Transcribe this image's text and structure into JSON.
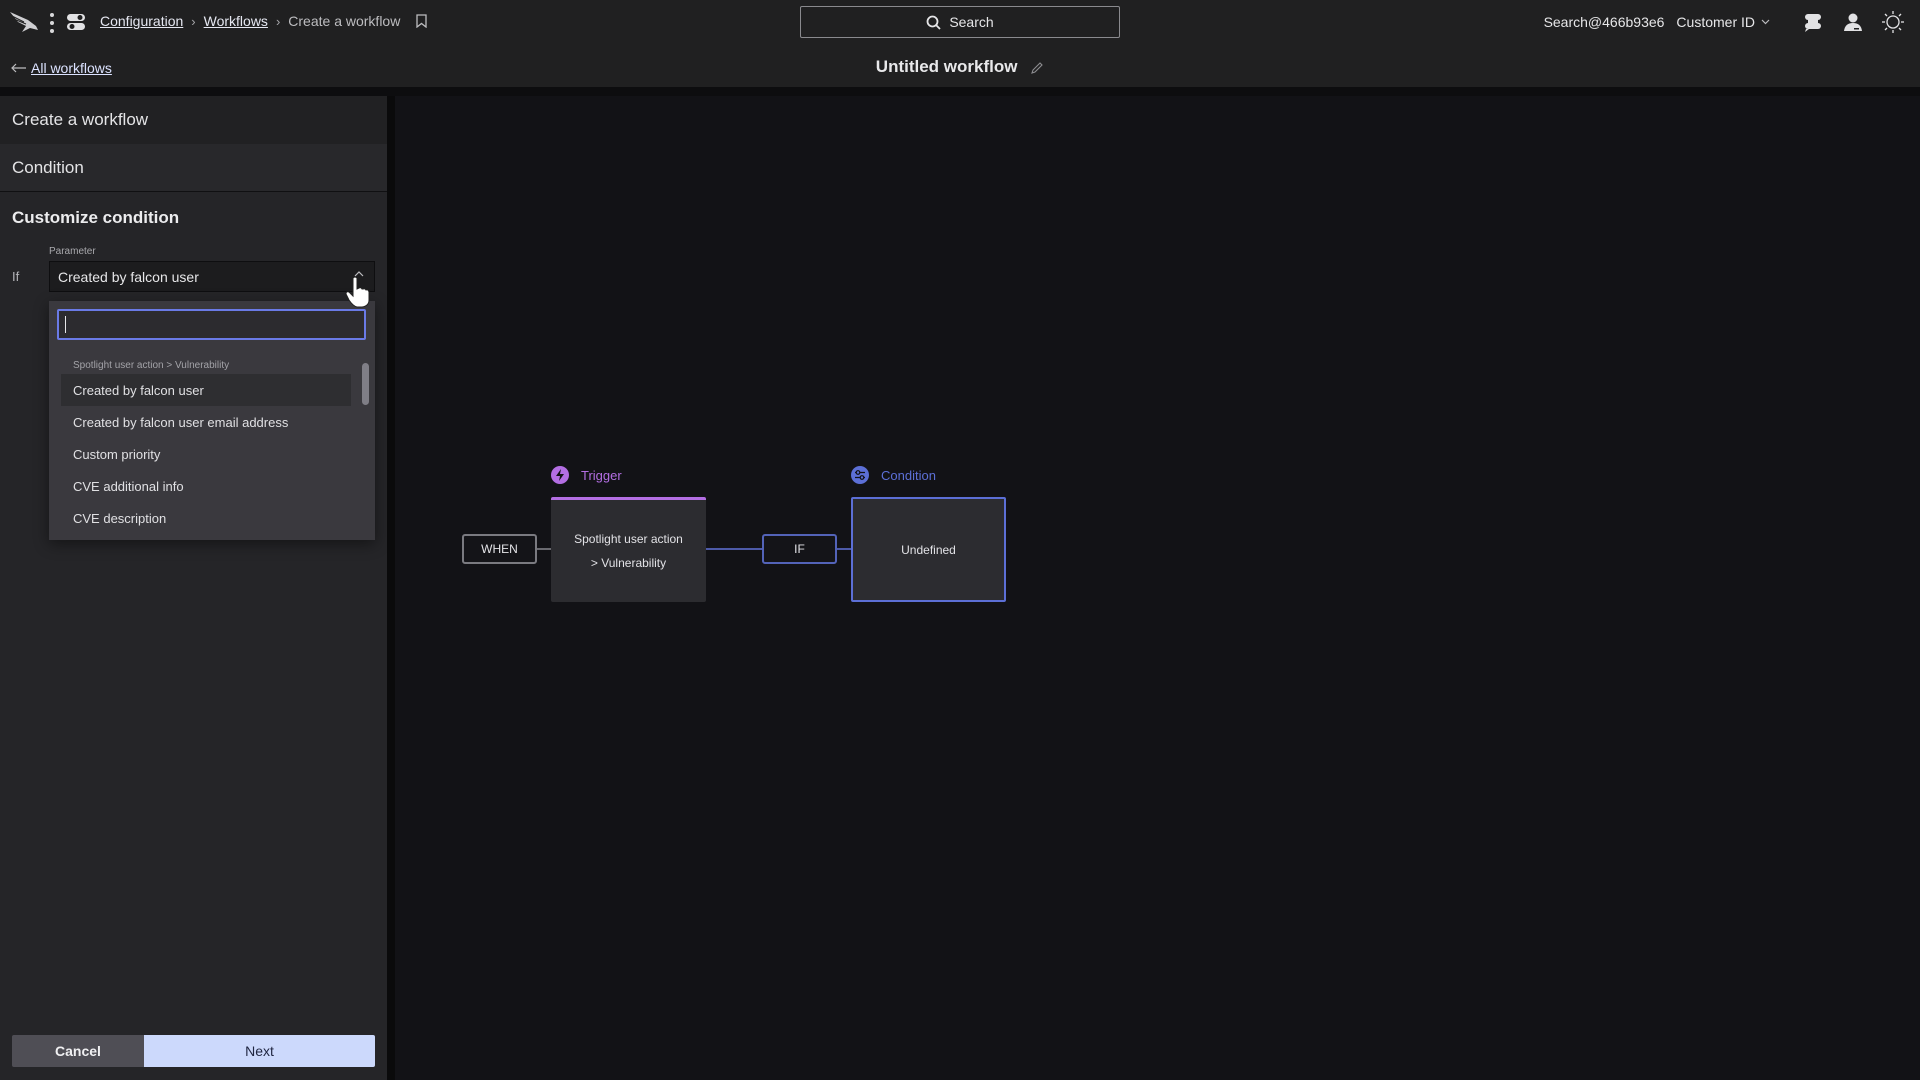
{
  "header": {
    "logo_icon": "falcon-logo-icon",
    "breadcrumb": [
      {
        "label": "Configuration",
        "link": true
      },
      {
        "label": "Workflows",
        "link": true
      },
      {
        "label": "Create a workflow",
        "link": false
      }
    ],
    "search_label": "Search",
    "account": "Search@466b93e6",
    "customer_id_label": "Customer ID",
    "back_link": "All workflows",
    "workflow_title": "Untitled workflow"
  },
  "panel": {
    "header": "Create a workflow",
    "step": "Condition",
    "section_title": "Customize condition",
    "if_label": "If",
    "parameter_label": "Parameter",
    "parameter_value": "Created by falcon user",
    "dropdown": {
      "search_value": "",
      "group_label": "Spotlight user action > Vulnerability",
      "items": [
        {
          "label": "Created by falcon user",
          "active": true
        },
        {
          "label": "Created by falcon user email address",
          "active": false
        },
        {
          "label": "Custom priority",
          "active": false
        },
        {
          "label": "CVE additional info",
          "active": false
        },
        {
          "label": "CVE description",
          "active": false
        }
      ]
    },
    "cancel_label": "Cancel",
    "next_label": "Next"
  },
  "canvas": {
    "when_label": "WHEN",
    "if_label": "IF",
    "trigger": {
      "title": "Trigger",
      "line1": "Spotlight user action",
      "line2": "> Vulnerability",
      "color": "#b36ee3"
    },
    "condition": {
      "title": "Condition",
      "body": "Undefined",
      "color": "#5c6fd6"
    }
  }
}
